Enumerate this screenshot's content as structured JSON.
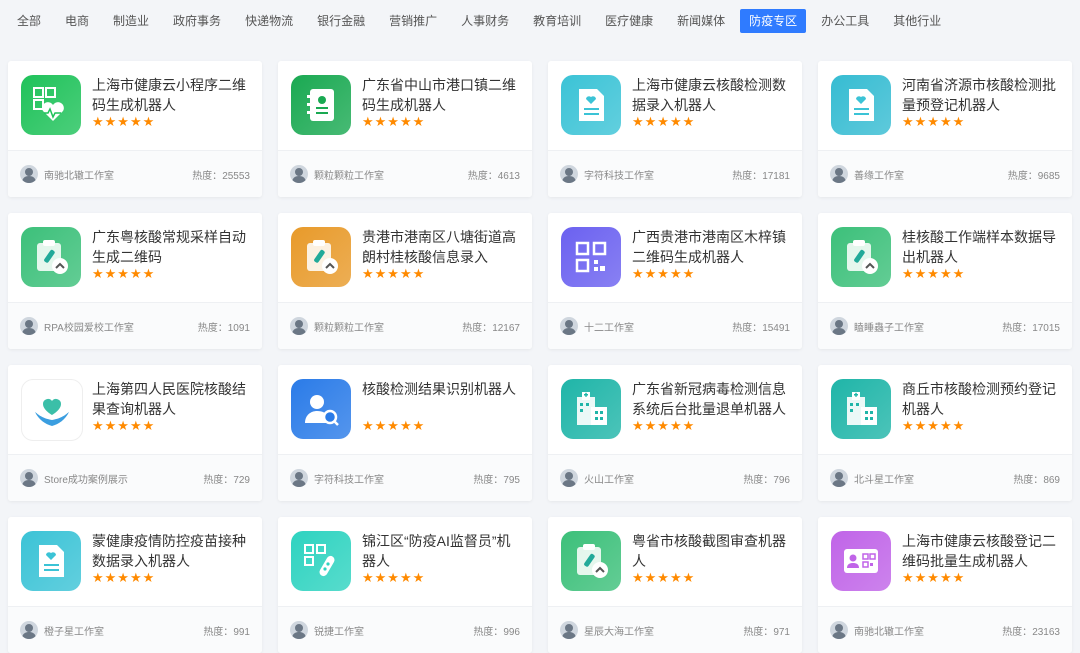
{
  "tabs": [
    {
      "label": "全部",
      "active": false
    },
    {
      "label": "电商",
      "active": false
    },
    {
      "label": "制造业",
      "active": false
    },
    {
      "label": "政府事务",
      "active": false
    },
    {
      "label": "快递物流",
      "active": false
    },
    {
      "label": "银行金融",
      "active": false
    },
    {
      "label": "营销推广",
      "active": false
    },
    {
      "label": "人事财务",
      "active": false
    },
    {
      "label": "教育培训",
      "active": false
    },
    {
      "label": "医疗健康",
      "active": false
    },
    {
      "label": "新闻媒体",
      "active": false
    },
    {
      "label": "防疫专区",
      "active": true
    },
    {
      "label": "办公工具",
      "active": false
    },
    {
      "label": "其他行业",
      "active": false
    }
  ],
  "stars": "★★★★★",
  "heat_label": "热度：",
  "cards": [
    {
      "title": "上海市健康云小程序二维码生成机器人",
      "author": "南驰北辙工作室",
      "heat": "25553",
      "icon": "qr-heart-icon",
      "color": "#1fc25a"
    },
    {
      "title": "广东省中山市港口镇二维码生成机器人",
      "author": "颗粒颗粒工作室",
      "heat": "4613",
      "icon": "contact-card-icon",
      "color": "#1aa952"
    },
    {
      "title": "上海市健康云核酸检测数据录入机器人",
      "author": "字符科技工作室",
      "heat": "17181",
      "icon": "medical-doc-icon",
      "color": "#3bc3d6"
    },
    {
      "title": "河南省济源市核酸检测批量预登记机器人",
      "author": "善缘工作室",
      "heat": "9685",
      "icon": "medical-doc-icon",
      "color": "#36bcd2"
    },
    {
      "title": "广东粤核酸常规采样自动生成二维码",
      "author": "RPA校园爱校工作室",
      "heat": "1091",
      "icon": "clipboard-test-tube-icon",
      "color": "#3cc07a"
    },
    {
      "title": "贵港市港南区八塘街道高朗村桂核酸信息录入",
      "author": "颗粒颗粒工作室",
      "heat": "12167",
      "icon": "clipboard-test-tube-icon",
      "color": "#e89a2a"
    },
    {
      "title": "广西贵港市港南区木梓镇二维码生成机器人",
      "author": "十二工作室",
      "heat": "15491",
      "icon": "qr-code-icon",
      "color": "#6b61f0"
    },
    {
      "title": "桂核酸工作端样本数据导出机器人",
      "author": "瞌睡蟲子工作室",
      "heat": "17015",
      "icon": "clipboard-test-tube-icon",
      "color": "#3cc07a"
    },
    {
      "title": "上海第四人民医院核酸结果查询机器人",
      "author": "Store成功案例展示",
      "heat": "729",
      "icon": "hands-heart-icon",
      "color": "#ffffff"
    },
    {
      "title": "核酸检测结果识别机器人",
      "author": "字符科技工作室",
      "heat": "795",
      "icon": "person-search-icon",
      "color": "#2a7be8"
    },
    {
      "title": "广东省新冠病毒检测信息系统后台批量退单机器人",
      "author": "火山工作室",
      "heat": "796",
      "icon": "hospital-icon",
      "color": "#1fb5a8"
    },
    {
      "title": "商丘市核酸检测预约登记机器人",
      "author": "北斗星工作室",
      "heat": "869",
      "icon": "hospital-icon",
      "color": "#1fb5a8"
    },
    {
      "title": "蒙健康疫情防控疫苗接种数据录入机器人",
      "author": "橙子星工作室",
      "heat": "991",
      "icon": "medical-doc-icon",
      "color": "#3bc3d6"
    },
    {
      "title": "锦江区“防疫AI监督员”机器人",
      "author": "锐捷工作室",
      "heat": "996",
      "icon": "qr-test-tube-icon",
      "color": "#2ed3c0"
    },
    {
      "title": "粤省市核酸截图审查机器人",
      "author": "星辰大海工作室",
      "heat": "971",
      "icon": "clipboard-test-tube-icon",
      "color": "#3cc07a"
    },
    {
      "title": "上海市健康云核酸登记二维码批量生成机器人",
      "author": "南驰北辙工作室",
      "heat": "23163",
      "icon": "id-card-qr-icon",
      "color": "#c064e8"
    }
  ]
}
